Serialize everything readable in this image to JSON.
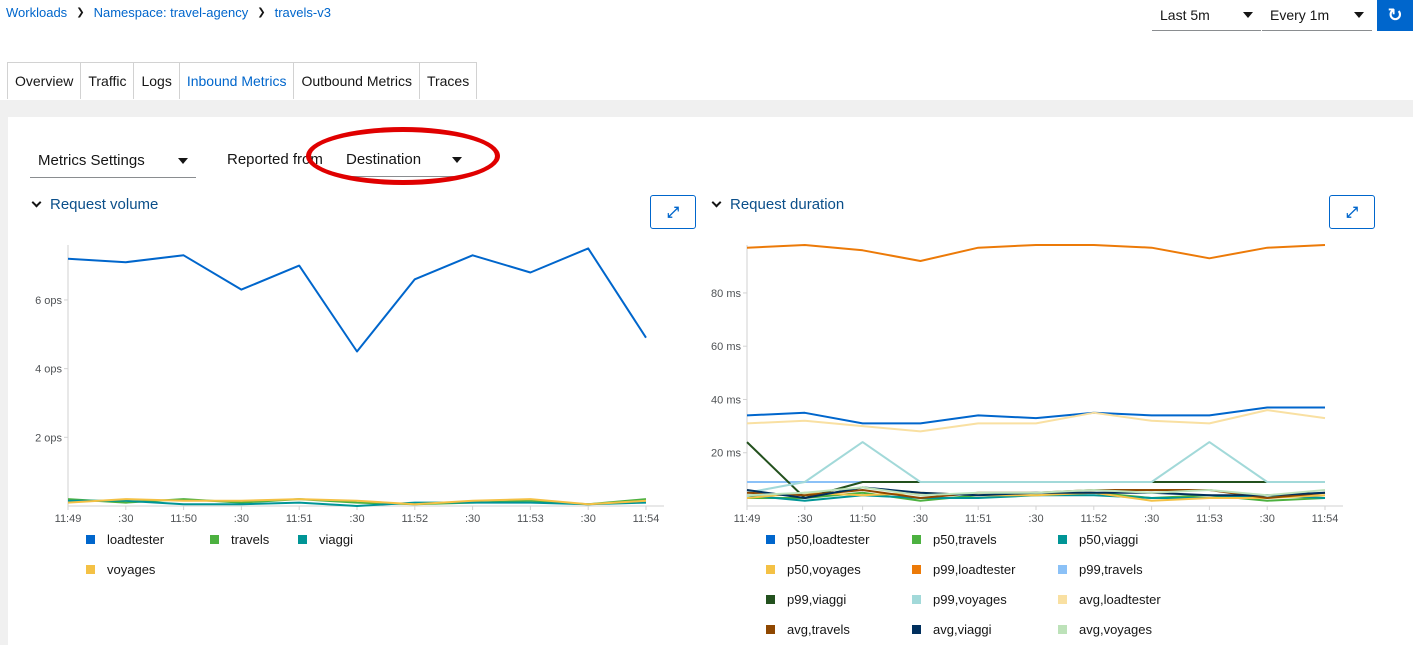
{
  "breadcrumb": [
    "Workloads",
    "Namespace: travel-agency",
    "travels-v3"
  ],
  "controls": {
    "time_range": "Last 5m",
    "refresh_interval": "Every 1m",
    "refresh_icon": "sync-icon"
  },
  "tabs": [
    {
      "label": "Overview",
      "active": false
    },
    {
      "label": "Traffic",
      "active": false
    },
    {
      "label": "Logs",
      "active": false
    },
    {
      "label": "Inbound Metrics",
      "active": true
    },
    {
      "label": "Outbound Metrics",
      "active": false
    },
    {
      "label": "Traces",
      "active": false
    }
  ],
  "toolbar": {
    "metrics_settings": "Metrics Settings",
    "reported_from_label": "Reported from",
    "reported_from_value": "Destination",
    "annotation": "red ellipse around Reported from selector"
  },
  "icons": {
    "expand": "expand-icon",
    "collapse": "chevron-down-icon"
  },
  "chart_data": [
    {
      "type": "line",
      "title": "Request volume",
      "x_labels": [
        "11:49",
        ":30",
        "11:50",
        ":30",
        "11:51",
        ":30",
        "11:52",
        ":30",
        "11:53",
        ":30",
        "11:54"
      ],
      "ylim": [
        0,
        7.6
      ],
      "y_ticks": [
        2,
        4,
        6
      ],
      "y_unit": " ops",
      "grid": false,
      "legend_position": "bottom",
      "series": [
        {
          "name": "loadtester",
          "color": "#0066cc",
          "values": [
            7.2,
            7.1,
            7.3,
            6.3,
            7.0,
            4.5,
            6.6,
            7.3,
            6.8,
            7.5,
            4.9
          ]
        },
        {
          "name": "travels",
          "color": "#4cb140",
          "values": [
            0.2,
            0.1,
            0.2,
            0.1,
            0.2,
            0.1,
            0.05,
            0.1,
            0.15,
            0.05,
            0.2
          ]
        },
        {
          "name": "viaggi",
          "color": "#009596",
          "values": [
            0.15,
            0.15,
            0.05,
            0.05,
            0.1,
            0.0,
            0.1,
            0.1,
            0.1,
            0.05,
            0.1
          ]
        },
        {
          "name": "voyages",
          "color": "#f4c145",
          "values": [
            0.1,
            0.2,
            0.15,
            0.15,
            0.2,
            0.15,
            0.05,
            0.15,
            0.2,
            0.05,
            0.15
          ]
        }
      ]
    },
    {
      "type": "line",
      "title": "Request duration",
      "x_labels": [
        "11:49",
        ":30",
        "11:50",
        ":30",
        "11:51",
        ":30",
        "11:52",
        ":30",
        "11:53",
        ":30",
        "11:54"
      ],
      "ylim": [
        0,
        98
      ],
      "y_ticks": [
        20,
        40,
        60,
        80
      ],
      "y_unit": " ms",
      "grid": false,
      "legend_position": "bottom",
      "series": [
        {
          "name": "p50,loadtester",
          "color": "#0066cc",
          "values": [
            34,
            35,
            31,
            31,
            34,
            33,
            35,
            34,
            34,
            37,
            37
          ]
        },
        {
          "name": "p50,travels",
          "color": "#4cb140",
          "values": [
            3,
            3,
            5,
            2,
            4,
            4,
            5,
            3,
            4,
            2,
            3
          ]
        },
        {
          "name": "p50,viaggi",
          "color": "#009596",
          "values": [
            4,
            2,
            4,
            3,
            3,
            4,
            4,
            3,
            3,
            4,
            3
          ]
        },
        {
          "name": "p50,voyages",
          "color": "#f4c145",
          "values": [
            3,
            5,
            4,
            5,
            4,
            4,
            5,
            2,
            3,
            3,
            4
          ]
        },
        {
          "name": "p99,loadtester",
          "color": "#ec7a08",
          "values": [
            97,
            98,
            96,
            92,
            97,
            98,
            98,
            97,
            93,
            97,
            98
          ]
        },
        {
          "name": "p99,travels",
          "color": "#8bc1f7",
          "values": [
            9,
            9,
            9,
            9,
            9,
            9,
            9,
            9,
            9,
            9,
            9
          ]
        },
        {
          "name": "p99,viaggi",
          "color": "#23511e",
          "values": [
            24,
            3,
            9,
            9,
            9,
            9,
            9,
            9,
            9,
            9,
            9
          ]
        },
        {
          "name": "p99,voyages",
          "color": "#a2d9d9",
          "values": [
            5,
            9,
            24,
            9,
            9,
            9,
            9,
            9,
            24,
            9,
            9
          ]
        },
        {
          "name": "avg,loadtester",
          "color": "#f9e0a2",
          "values": [
            31,
            32,
            30,
            28,
            31,
            31,
            35,
            32,
            31,
            36,
            33
          ]
        },
        {
          "name": "avg,travels",
          "color": "#8f4700",
          "values": [
            5,
            4,
            6,
            3,
            5,
            5,
            6,
            6,
            6,
            3,
            5
          ]
        },
        {
          "name": "avg,viaggi",
          "color": "#002f5d",
          "values": [
            6,
            3,
            7,
            5,
            4,
            5,
            5,
            5,
            4,
            4,
            5
          ]
        },
        {
          "name": "avg,voyages",
          "color": "#bde2b9",
          "values": [
            4,
            5,
            7,
            4,
            5,
            5,
            6,
            5,
            6,
            4,
            6
          ]
        }
      ]
    }
  ]
}
